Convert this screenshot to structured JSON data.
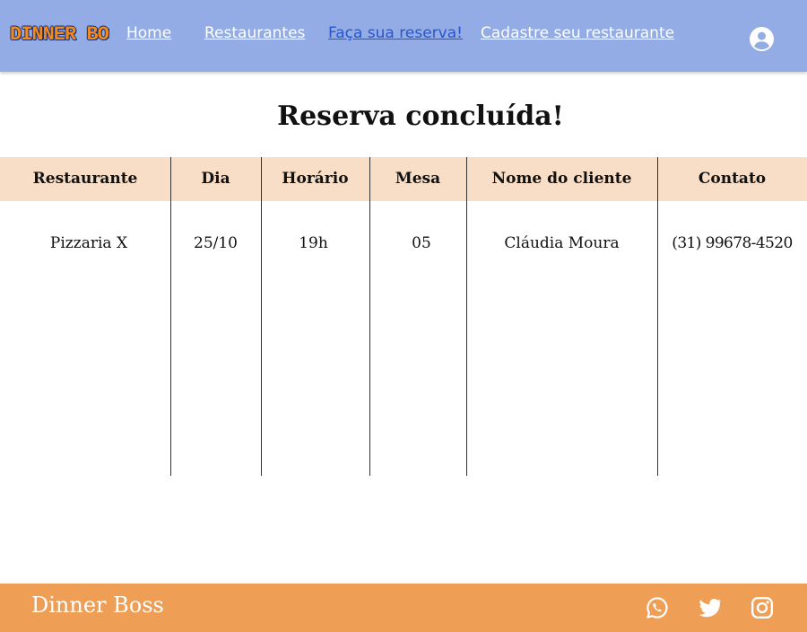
{
  "header": {
    "logo_text": "DINNER BOSS",
    "nav": [
      {
        "label": "Home"
      },
      {
        "label": "Restaurantes"
      },
      {
        "label": "Faça sua reserva!"
      },
      {
        "label": "Cadastre seu restaurante"
      }
    ],
    "active_nav": "Faça sua reserva!",
    "profile_icon": "user-circle-icon"
  },
  "main": {
    "title": "Reserva concluída!",
    "table": {
      "columns": [
        "Restaurante",
        "Dia",
        "Horário",
        "Mesa",
        "Nome do cliente",
        "Contato"
      ],
      "rows": [
        [
          "Pizzaria X",
          "25/10",
          "19h",
          "05",
          "Cláudia Moura",
          "(31) 99678-4520"
        ]
      ]
    }
  },
  "footer": {
    "brand": "Dinner Boss",
    "social_icons": [
      "whatsapp-icon",
      "twitter-icon",
      "instagram-icon"
    ]
  },
  "colors": {
    "header_bg": "#93ace6",
    "active_link": "#2a56c8",
    "table_header_bg": "#f8dec6",
    "footer_bg": "#ee9e55"
  }
}
